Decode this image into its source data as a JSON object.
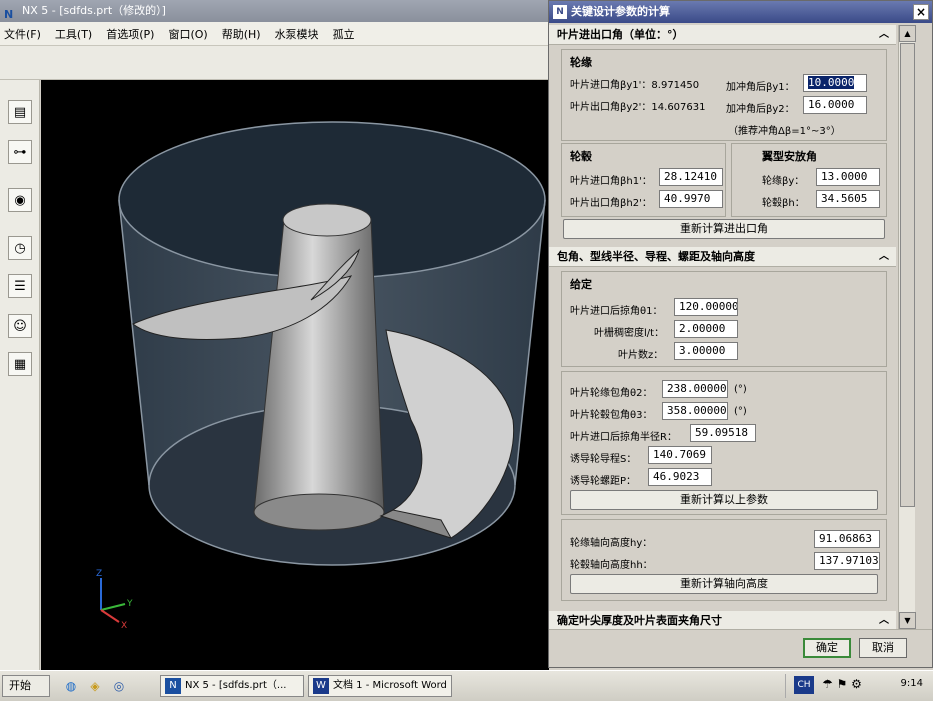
{
  "app": {
    "title": "NX 5 - [sdfds.prt（修改的）]",
    "menu": [
      "文件(F)",
      "工具(T)",
      "首选项(P)",
      "窗口(O)",
      "帮助(H)",
      "水泵模块",
      "孤立"
    ]
  },
  "left_toolbar": [
    "assembly-navigator-icon",
    "constraint-navigator-icon",
    "part-navigator-icon",
    "history-icon",
    "reuse-library-icon",
    "roles-icon",
    "system-materials-icon"
  ],
  "viewport": {
    "axis_labels": {
      "x": "X",
      "y": "Y",
      "z": "Z"
    }
  },
  "dialog": {
    "title": "关键设计参数的计算",
    "close": "×",
    "sections": {
      "inlet_outlet": "叶片进出口角（单位：°）",
      "wrap": "包角、型线半径、导程、螺距及轴向高度",
      "tip": "确定叶尖厚度及叶片表面夹角尺寸"
    },
    "rim": {
      "title": "轮缘",
      "inlet_label": "叶片进口角βy1'：8.971450",
      "outlet_label": "叶片出口角βy2'：14.607631",
      "attack1_label": "加冲角后βy1：",
      "attack1_value": "10.0000",
      "attack2_label": "加冲角后βy2：",
      "attack2_value": "16.0000",
      "hint": "（推荐冲角Δβ=1°~3°）"
    },
    "hub": {
      "title": "轮毂",
      "inlet_label": "叶片进口角βh1'：",
      "inlet_value": "28.12410",
      "outlet_label": "叶片出口角βh2'：",
      "outlet_value": "40.9970"
    },
    "install": {
      "title": "翼型安放角",
      "rim_label": "轮缘βy：",
      "rim_value": "13.0000",
      "hub_label": "轮毂βh：",
      "hub_value": "34.5605"
    },
    "recalc_angles": "重新计算进出口角",
    "given": {
      "title": "给定",
      "sweep_label": "叶片进口后掠角θ1：",
      "sweep_value": "120.00000",
      "density_label": "叶栅稠密度l/t：",
      "density_value": "2.00000",
      "count_label": "叶片数z：",
      "count_value": "3.00000"
    },
    "computed": {
      "rim_wrap_label": "叶片轮缘包角θ2：",
      "rim_wrap_value": "238.00000",
      "rim_wrap_unit": "(°)",
      "hub_wrap_label": "叶片轮毂包角θ3：",
      "hub_wrap_value": "358.00000",
      "hub_wrap_unit": "(°)",
      "radius_label": "叶片进口后掠角半径R：",
      "radius_value": "59.09518",
      "lead_label": "诱导轮导程S：",
      "lead_value": "140.7069",
      "pitch_label": "诱导轮螺距P：",
      "pitch_value": "46.9023",
      "recalc": "重新计算以上参数"
    },
    "height": {
      "rim_label": "轮缘轴向高度hy：",
      "rim_value": "91.06863",
      "hub_label": "轮毂轴向高度hh：",
      "hub_value": "137.97103",
      "recalc": "重新计算轴向高度"
    },
    "ok": "确定",
    "cancel": "取消"
  },
  "taskbar": {
    "start": "开始",
    "tasks": [
      "NX 5 - [sdfds.prt（...",
      "文档 1 - Microsoft Word"
    ],
    "lang": "CH",
    "time": "9:14"
  }
}
